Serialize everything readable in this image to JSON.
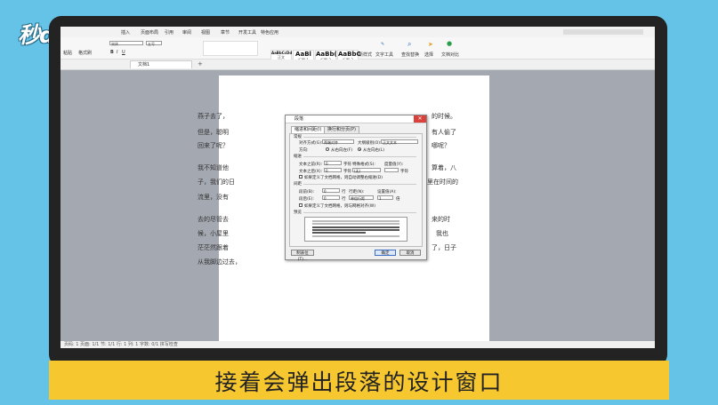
{
  "watermark": {
    "logo_text": "秒dong视频"
  },
  "menubar": {
    "items": [
      "插入",
      "页面布局",
      "引用",
      "审阅",
      "视图",
      "章节",
      "开发工具",
      "特色应用"
    ]
  },
  "ribbon": {
    "paste_label": "粘贴",
    "font_name": "宋体",
    "font_size": "五号",
    "styles": [
      {
        "sample": "AaBbCcDd",
        "name": "正文"
      },
      {
        "sample": "AaBl",
        "name": "标题 1"
      },
      {
        "sample": "AaBb(",
        "name": "标题 2"
      },
      {
        "sample": "AaBbC",
        "name": "标题 3"
      }
    ],
    "new_style_label": "新样式",
    "text_tools_label": "文字工具",
    "find_replace_label": "查找替换",
    "select_label": "选择",
    "format_label": "格式刷",
    "doc_compare_label": "文档对比"
  },
  "tabs": {
    "doc_tab": "文档1"
  },
  "document": {
    "lines": [
      "燕子去了，",
      "但是，聪明",
      "回来了呢？",
      "我不知道他",
      "子，我们的日",
      "流里，没有",
      "去的尽管去",
      "候，小屋里",
      "茫茫然跟着",
      "从我脚边过去，"
    ],
    "right_fragments": [
      "的时候。",
      "有人偷了",
      "哪呢？",
      "算着，八",
      "里在时间的",
      "来的时",
      "我也",
      "了，日子",
      ""
    ]
  },
  "dialog": {
    "title": "段落",
    "tabs": [
      "缩进和间距(I)",
      "换行和分页(P)"
    ],
    "general_label": "常规",
    "alignment_label": "对齐方式(G):",
    "alignment_value": "两端对齐",
    "outline_label": "大纲级别(O):",
    "outline_value": "正文文本",
    "direction_label": "方向:",
    "rtl_label": "从右向左(F)",
    "ltr_label": "从左向右(L)",
    "indent_label": "缩进",
    "before_text_label": "文本之前(R):",
    "before_text_value": "0",
    "char_unit": "字符",
    "special_label": "特殊格式(S):",
    "special_value": "(无)",
    "measure_label": "度量值(Y):",
    "after_text_label": "文本之后(X):",
    "after_text_value": "0",
    "auto_adjust_indent": "如果定义了文档网格，则自动调整右缩进(D)",
    "spacing_label": "间距",
    "before_label": "段前(B):",
    "before_value": "0",
    "after_label": "段后(E):",
    "after_value": "0",
    "line_unit": "行",
    "line_spacing_label": "行距(N):",
    "line_spacing_value": "单倍行距",
    "setting_label": "设置值(A):",
    "setting_value": "1",
    "times_unit": "倍",
    "snap_grid": "如果定义了文档网格，则与网格对齐(W)",
    "preview_label": "预览",
    "tabs_button": "制表位(T)...",
    "ok_button": "确定",
    "cancel_button": "取消"
  },
  "statusbar": {
    "text": "页码: 1  页面: 1/1  节: 1/1  行: 1  列: 1  字数: 0/1  拼写检查"
  },
  "caption": {
    "text": "接着会弹出段落的设计窗口"
  }
}
